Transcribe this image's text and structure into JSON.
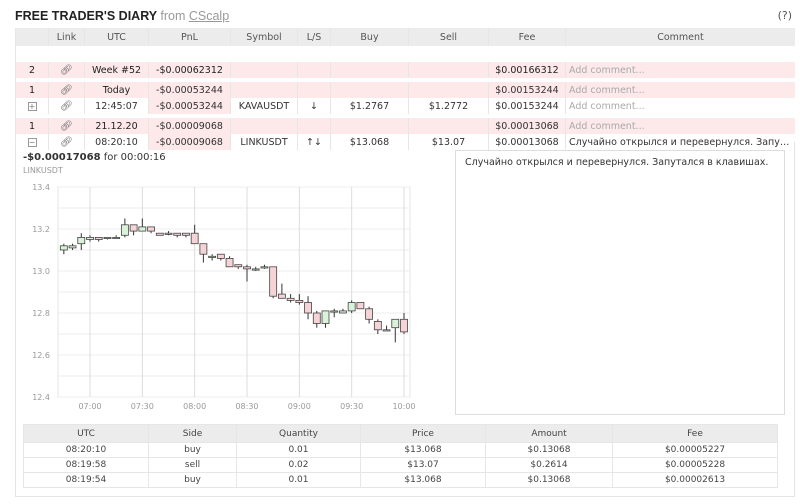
{
  "header": {
    "title": "FREE TRADER'S DIARY",
    "from": "from",
    "brand": "CScalp",
    "help": "(?)"
  },
  "columns": [
    "",
    "Link",
    "UTC",
    "PnL",
    "Symbol",
    "L/S",
    "Buy",
    "Sell",
    "Fee",
    "Comment"
  ],
  "rows": [
    {
      "kind": "week",
      "count": "2",
      "utc": "Week #52",
      "pnl": "-$0.00062312",
      "symbol": "",
      "ls": "",
      "buy": "",
      "sell": "",
      "fee": "$0.00166312",
      "comment": "Add comment..."
    },
    {
      "kind": "day",
      "count": "1",
      "utc": "Today",
      "pnl": "-$0.00053244",
      "symbol": "",
      "ls": "",
      "buy": "",
      "sell": "",
      "fee": "$0.00153244",
      "comment": "Add comment..."
    },
    {
      "kind": "trade",
      "count": "+",
      "utc": "12:45:07",
      "pnl": "-$0.00053244",
      "symbol": "KAVAUSDT",
      "ls": "↓",
      "buy": "$1.2767",
      "sell": "$1.2772",
      "fee": "$0.00153244",
      "comment": "Add comment..."
    },
    {
      "kind": "day",
      "count": "1",
      "utc": "21.12.20",
      "pnl": "-$0.00009068",
      "symbol": "",
      "ls": "",
      "buy": "",
      "sell": "",
      "fee": "$0.00013068",
      "comment": "Add comment..."
    },
    {
      "kind": "trade",
      "count": "−",
      "utc": "08:20:10",
      "pnl": "-$0.00009068",
      "symbol": "LINKUSDT",
      "ls": "↑↓",
      "buy": "$13.068",
      "sell": "$13.07",
      "fee": "$0.00013068",
      "comment": "Случайно открылся и перевернулся. Запутал..."
    }
  ],
  "detail": {
    "pnl": "-$0.00017068",
    "for": "for",
    "duration": "00:00:16",
    "symbol": "LINKUSDT",
    "comment": "Случайно открылся и перевернулся. Запутался в клавишах."
  },
  "chart_data": {
    "type": "candlestick",
    "symbol": "LINKUSDT",
    "ylim": [
      12.4,
      13.4
    ],
    "yticks": [
      "12.4",
      "12.6",
      "12.8",
      "13.0",
      "13.2",
      "13.4"
    ],
    "xticks": [
      "07:00",
      "07:30",
      "08:00",
      "08:30",
      "09:00",
      "09:30",
      "10:00"
    ],
    "interval_min": 5,
    "start": "06:45",
    "ohlc": [
      [
        13.1,
        13.13,
        13.08,
        13.12
      ],
      [
        13.11,
        13.13,
        13.1,
        13.12
      ],
      [
        13.13,
        13.18,
        13.1,
        13.16
      ],
      [
        13.15,
        13.17,
        13.14,
        13.16
      ],
      [
        13.16,
        13.16,
        13.14,
        13.15
      ],
      [
        13.16,
        13.16,
        13.15,
        13.16
      ],
      [
        13.16,
        13.17,
        13.16,
        13.16
      ],
      [
        13.17,
        13.25,
        13.16,
        13.22
      ],
      [
        13.22,
        13.22,
        13.17,
        13.19
      ],
      [
        13.19,
        13.25,
        13.19,
        13.21
      ],
      [
        13.21,
        13.21,
        13.18,
        13.19
      ],
      [
        13.18,
        13.18,
        13.17,
        13.17
      ],
      [
        13.18,
        13.19,
        13.17,
        13.18
      ],
      [
        13.18,
        13.18,
        13.16,
        13.17
      ],
      [
        13.18,
        13.18,
        13.16,
        13.17
      ],
      [
        13.18,
        13.22,
        13.13,
        13.13
      ],
      [
        13.13,
        13.13,
        13.04,
        13.08
      ],
      [
        13.07,
        13.08,
        13.05,
        13.07
      ],
      [
        13.08,
        13.08,
        13.05,
        13.06
      ],
      [
        13.06,
        13.07,
        13.02,
        13.02
      ],
      [
        13.03,
        13.03,
        13.01,
        13.02
      ],
      [
        13.02,
        13.03,
        12.95,
        13.01
      ],
      [
        13.01,
        13.02,
        13.0,
        13.01
      ],
      [
        13.02,
        13.03,
        13.01,
        13.02
      ],
      [
        13.02,
        13.02,
        12.87,
        12.88
      ],
      [
        12.89,
        12.94,
        12.87,
        12.87
      ],
      [
        12.87,
        12.89,
        12.85,
        12.86
      ],
      [
        12.86,
        12.89,
        12.84,
        12.85
      ],
      [
        12.85,
        12.88,
        12.77,
        12.8
      ],
      [
        12.8,
        12.81,
        12.73,
        12.75
      ],
      [
        12.75,
        12.81,
        12.73,
        12.81
      ],
      [
        12.81,
        12.82,
        12.78,
        12.81
      ],
      [
        12.8,
        12.82,
        12.8,
        12.81
      ],
      [
        12.81,
        12.86,
        12.8,
        12.85
      ],
      [
        12.85,
        12.85,
        12.82,
        12.82
      ],
      [
        12.82,
        12.83,
        12.75,
        12.77
      ],
      [
        12.76,
        12.77,
        12.7,
        12.72
      ],
      [
        12.72,
        12.74,
        12.72,
        12.72
      ],
      [
        12.73,
        12.77,
        12.66,
        12.77
      ],
      [
        12.77,
        12.8,
        12.7,
        12.71
      ]
    ],
    "colors": {
      "up": "#d9f2d9",
      "down": "#f5d3d7",
      "wick": "#333"
    }
  },
  "fills": {
    "columns": [
      "UTC",
      "Side",
      "Quantity",
      "Price",
      "Amount",
      "Fee"
    ],
    "rows": [
      [
        "08:20:10",
        "buy",
        "0.01",
        "$13.068",
        "$0.13068",
        "$0.00005227"
      ],
      [
        "08:19:58",
        "sell",
        "0.02",
        "$13.07",
        "$0.2614",
        "$0.00005228"
      ],
      [
        "08:19:54",
        "buy",
        "0.01",
        "$13.068",
        "$0.13068",
        "$0.00002613"
      ]
    ]
  }
}
